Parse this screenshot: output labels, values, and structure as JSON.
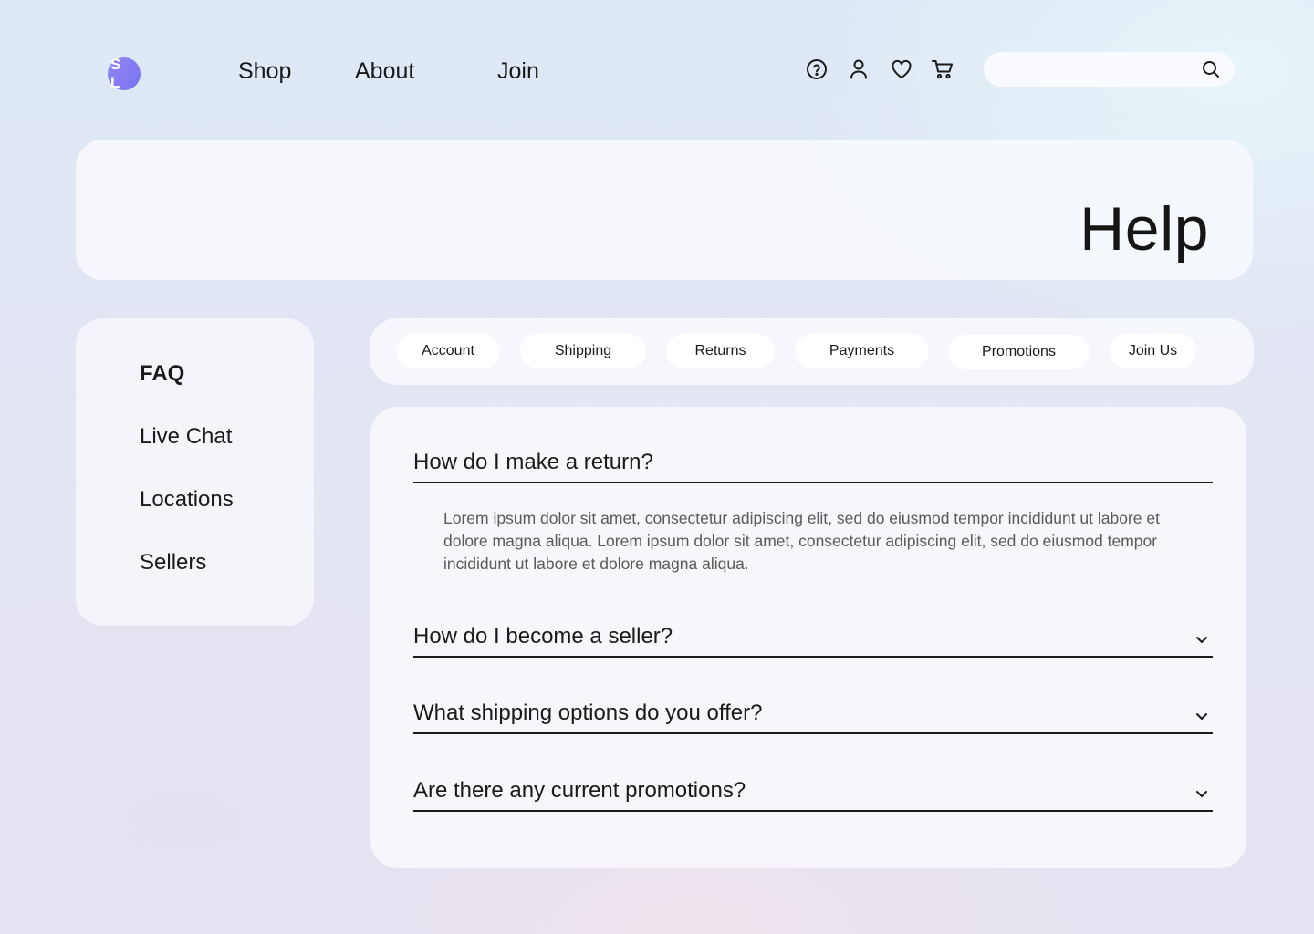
{
  "header": {
    "logo_text": "S L",
    "nav": [
      {
        "label": "Shop"
      },
      {
        "label": "About"
      },
      {
        "label": "Join"
      }
    ],
    "icons": [
      "help-icon",
      "user-icon",
      "heart-icon",
      "cart-icon"
    ],
    "search": {
      "placeholder": "",
      "value": "",
      "icon": "search-icon"
    }
  },
  "banner": {
    "title": "Help"
  },
  "sidebar": {
    "items": [
      {
        "label": "FAQ",
        "active": true
      },
      {
        "label": "Live Chat"
      },
      {
        "label": "Locations"
      },
      {
        "label": "Sellers"
      }
    ]
  },
  "tabs": [
    {
      "label": "Account"
    },
    {
      "label": "Shipping"
    },
    {
      "label": "Returns"
    },
    {
      "label": "Payments"
    },
    {
      "label": "Promotions"
    },
    {
      "label": "Join Us"
    }
  ],
  "faq": {
    "items": [
      {
        "question": "How do I make a return?",
        "expanded": true,
        "answer": "Lorem ipsum dolor sit amet, consectetur adipiscing elit, sed do eiusmod tempor incididunt ut labore et dolore magna aliqua. Lorem ipsum dolor sit amet, consectetur adipiscing elit, sed do eiusmod tempor incididunt ut labore et dolore magna aliqua."
      },
      {
        "question": "How do I become a seller?",
        "expanded": false
      },
      {
        "question": "What shipping options do you offer?",
        "expanded": false
      },
      {
        "question": "Are there any current promotions?",
        "expanded": false
      }
    ]
  },
  "colors": {
    "logo": "#8a82f3",
    "text": "#1a1a1a",
    "answer_text": "#5a5a5a"
  }
}
